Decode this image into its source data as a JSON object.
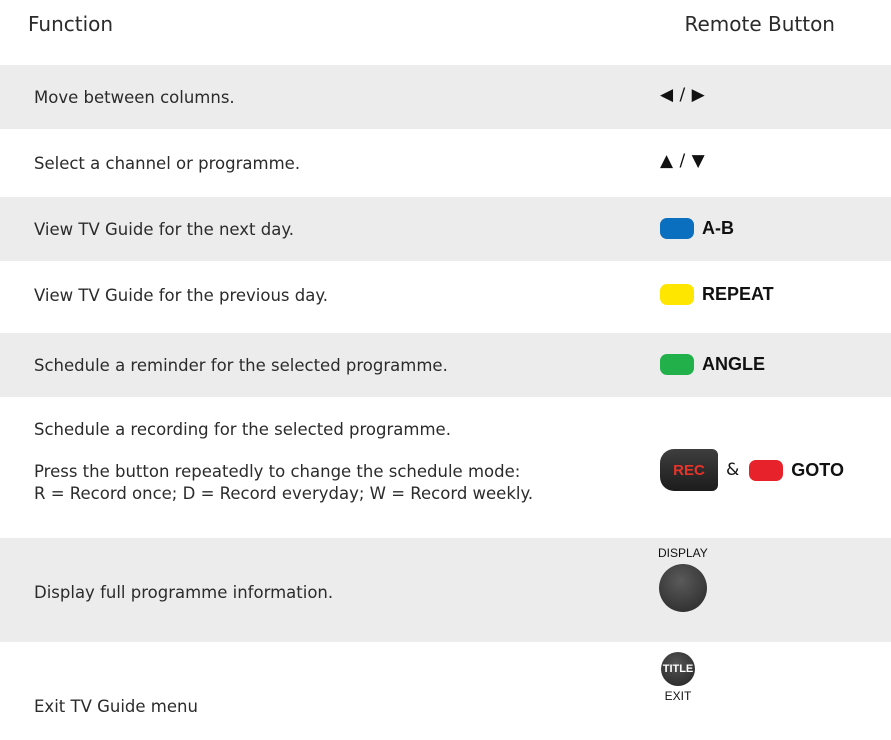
{
  "header": {
    "function_label": "Function",
    "remote_label": "Remote Button"
  },
  "rows": [
    {
      "function": "Move between columns.",
      "remote": {
        "type": "arrows",
        "text": "◀ / ▶"
      }
    },
    {
      "function": "Select a channel or programme.",
      "remote": {
        "type": "arrows",
        "text": "▲ / ▼"
      }
    },
    {
      "function": "View TV Guide for the next day.",
      "remote": {
        "type": "color",
        "color": "#0a6fbe",
        "label": "A-B",
        "icon": "blue-button-icon"
      }
    },
    {
      "function": "View TV Guide for the previous day.",
      "remote": {
        "type": "color",
        "color": "#ffe600",
        "label": "REPEAT",
        "icon": "yellow-button-icon"
      }
    },
    {
      "function": "Schedule a reminder for the selected programme.",
      "remote": {
        "type": "color",
        "color": "#22b04b",
        "label": "ANGLE",
        "icon": "green-button-icon"
      }
    },
    {
      "function": "Schedule a recording for the selected programme.",
      "function_note_1": "Press the button repeatedly to change the schedule mode:",
      "function_note_2": "R = Record once; D = Record everyday; W = Record weekly.",
      "remote": {
        "type": "rec",
        "rec_label": "REC",
        "amp": "&",
        "color": "#e8222a",
        "label": "GOTO",
        "icon": "red-button-icon"
      }
    },
    {
      "function": "Display full programme information.",
      "remote": {
        "type": "round",
        "caption": "DISPLAY",
        "icon": "display-button-icon"
      }
    },
    {
      "function": "Exit TV Guide menu",
      "remote": {
        "type": "round-small",
        "inner": "TITLE",
        "caption": "EXIT",
        "icon": "title-button-icon"
      }
    }
  ]
}
